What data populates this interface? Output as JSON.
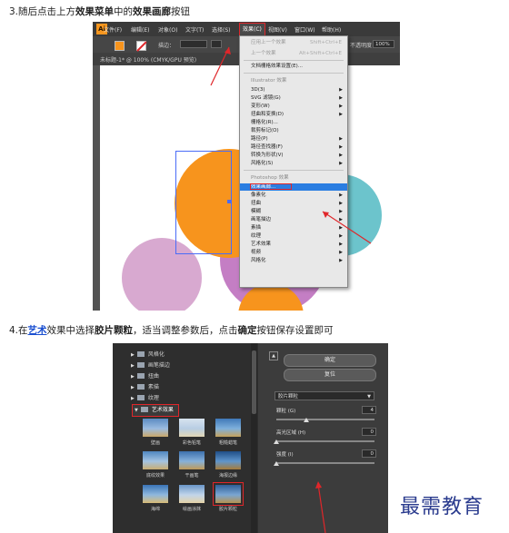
{
  "step3": {
    "prefix": "3.随后点击上方",
    "bold1": "效果菜单",
    "mid": "中的",
    "bold2": "效果画廊",
    "suffix": "按钮"
  },
  "step4": {
    "prefix": "4.在",
    "link": "艺术",
    "mid1": "效果中选择",
    "bold1": "胶片颗粒",
    "mid2": "，适当调整参数后，点击",
    "bold2": "确定",
    "suffix": "按钮保存设置即可"
  },
  "illustrator": {
    "logo": "Ai",
    "menu": [
      "文件(F)",
      "编辑(E)",
      "对象(O)",
      "文字(T)",
      "选择(S)",
      "效果(C)",
      "视图(V)",
      "窗口(W)",
      "帮助(H)"
    ],
    "active_menu_index": 5,
    "control": {
      "stroke_label": "描边：",
      "opacity_label": "不透明度：",
      "opacity_value": "100%"
    },
    "doc_tab": "未标题-1* @ 100% (CMYK/GPU 预览)",
    "effects_menu": {
      "apply_last": "应用上一个效果",
      "apply_last_shortcut": "Shift+Ctrl+E",
      "last_effect": "上一个效果",
      "last_effect_shortcut": "Alt+Shift+Ctrl+E",
      "raster_settings": "文档栅格效果设置(E)...",
      "illustrator_header": "Illustrator 效果",
      "illustrator_items": [
        "3D(3)",
        "SVG 滤镜(G)",
        "变形(W)",
        "扭曲和变换(D)",
        "栅格化(R)...",
        "裁剪标记(O)",
        "路径(P)",
        "路径查找器(F)",
        "转换为形状(V)",
        "风格化(S)"
      ],
      "photoshop_header": "Photoshop 效果",
      "gallery": "效果画廊...",
      "photoshop_items": [
        "像素化",
        "扭曲",
        "模糊",
        "画笔描边",
        "素描",
        "纹理",
        "艺术效果",
        "视频",
        "风格化"
      ]
    },
    "colors": {
      "orange": "#f7941d",
      "teal": "#6cc4cc",
      "lilac": "#d8a9d0",
      "purple": "#c47ec4"
    }
  },
  "filter_gallery": {
    "categories": [
      "风格化",
      "画笔描边",
      "扭曲",
      "素描",
      "纹理"
    ],
    "open_category": "艺术效果",
    "thumbnails": [
      "壁画",
      "彩色铅笔",
      "粗糙蜡笔",
      "底纹效果",
      "干画笔",
      "海报边缘",
      "海绵",
      "绘画涂抹",
      "胶片颗粒"
    ],
    "selected_thumbnail": "胶片颗粒",
    "ok_button": "确定",
    "reset_button": "复位",
    "filter_select": "胶片颗粒",
    "params": [
      {
        "label": "颗粒 (G)",
        "value": "4"
      },
      {
        "label": "高光区域 (H)",
        "value": "0"
      },
      {
        "label": "强度 (I)",
        "value": "0"
      }
    ]
  },
  "watermark": "最需教育"
}
